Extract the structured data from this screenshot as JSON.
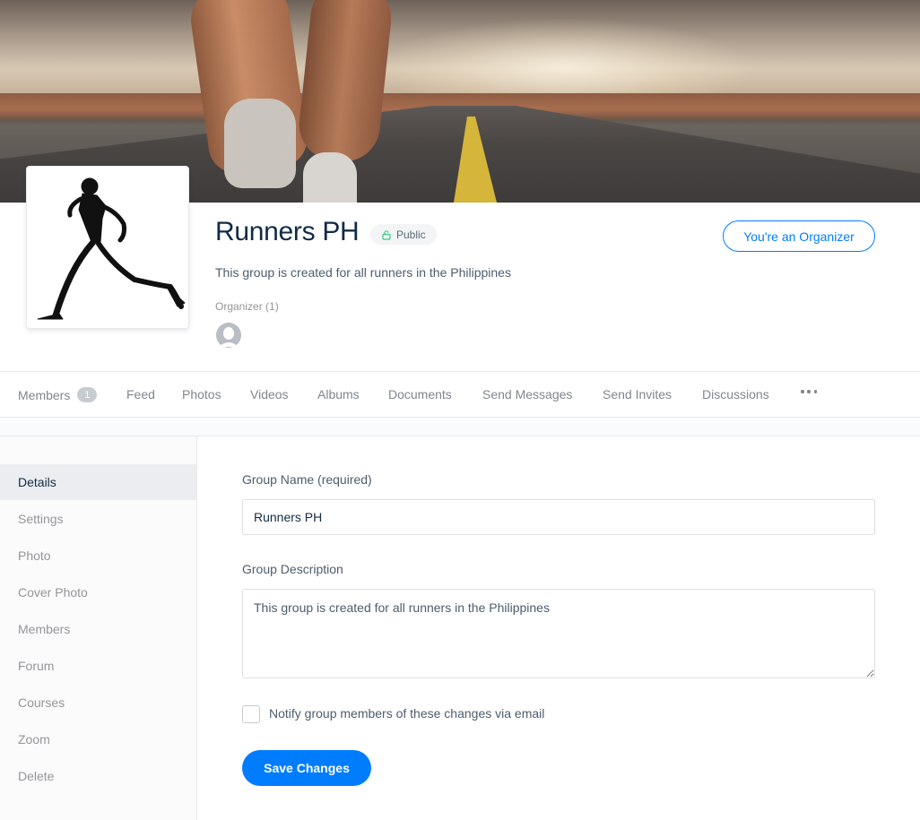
{
  "group": {
    "name": "Runners PH",
    "status": "Public",
    "description": "This group is created for all runners in the Philippines",
    "organizer_label": "Organizer (1)",
    "organizer_button": "You're an Organizer"
  },
  "nav": {
    "items": [
      {
        "label": "Members",
        "count": "1"
      },
      {
        "label": "Feed"
      },
      {
        "label": "Photos"
      },
      {
        "label": "Videos"
      },
      {
        "label": "Albums"
      },
      {
        "label": "Documents"
      },
      {
        "label": "Send Messages"
      },
      {
        "label": "Send Invites"
      },
      {
        "label": "Discussions"
      }
    ],
    "more_icon": "ellipsis-icon"
  },
  "sidebar": {
    "active": "Details",
    "items": [
      {
        "label": "Details"
      },
      {
        "label": "Settings"
      },
      {
        "label": "Photo"
      },
      {
        "label": "Cover Photo"
      },
      {
        "label": "Members"
      },
      {
        "label": "Forum"
      },
      {
        "label": "Courses"
      },
      {
        "label": "Zoom"
      },
      {
        "label": "Delete"
      }
    ]
  },
  "form": {
    "name_label": "Group Name (required)",
    "name_value": "Runners PH",
    "description_label": "Group Description",
    "description_value": "This group is created for all runners in the Philippines",
    "notify_label": "Notify group members of these changes via email",
    "notify_checked": false,
    "save_label": "Save Changes"
  },
  "colors": {
    "accent": "#007cff",
    "text": "#122b46",
    "public_lock": "#37c882"
  }
}
